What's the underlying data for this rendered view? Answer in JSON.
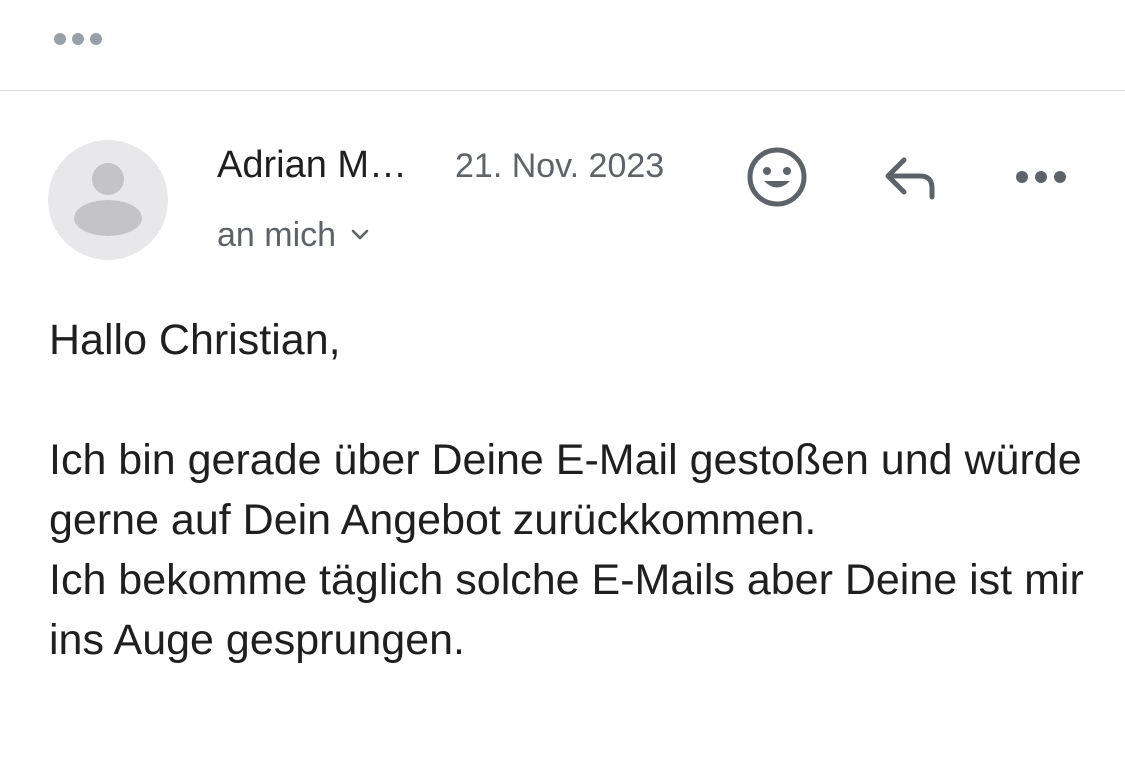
{
  "toolbar": {
    "more_icon": "more-horizontal-icon"
  },
  "email": {
    "sender": "Adrian M…",
    "date": "21. Nov. 2023",
    "recipient": "an mich",
    "avatar_icon": "person-placeholder-icon",
    "actions": {
      "emoji_icon": "smiley-icon",
      "reply_icon": "reply-arrow-icon",
      "more_icon": "more-horizontal-icon"
    },
    "greeting": "Hallo Christian,",
    "paragraph_1": "Ich bin gerade über Deine E-Mail gestoßen und würde gerne auf Dein Angebot zurückkommen.",
    "paragraph_2": "Ich bekomme täglich solche E-Mails aber Deine ist mir ins Auge gesprungen."
  },
  "colors": {
    "text_primary": "#1f1f1f",
    "text_secondary": "#5f6368",
    "icon": "#5f6368",
    "divider": "#dadce0",
    "avatar_bg": "#e8e8ea",
    "avatar_fg": "#c4c4c6"
  }
}
